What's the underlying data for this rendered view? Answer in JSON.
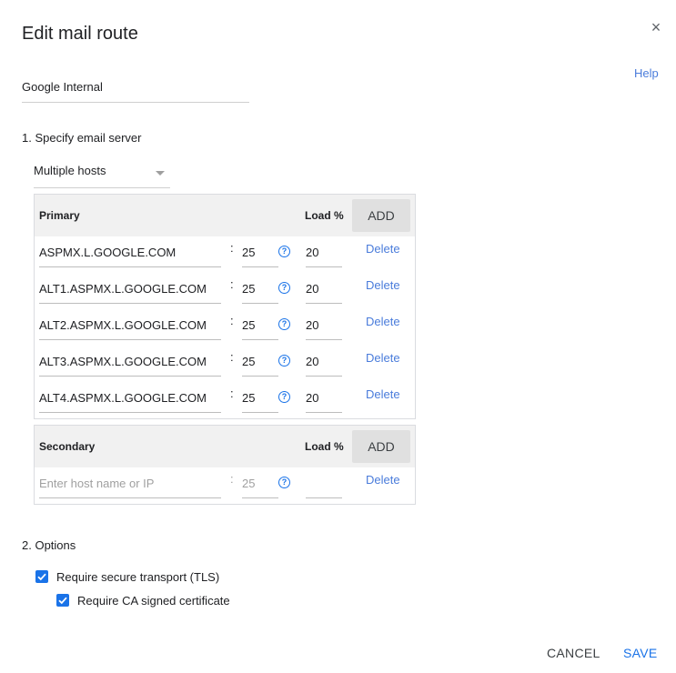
{
  "dialog": {
    "title": "Edit mail route",
    "close_glyph": "×",
    "help_label": "Help",
    "route_name": "Google Internal"
  },
  "server_section": {
    "label": "1. Specify email server",
    "mode_value": "Multiple hosts"
  },
  "primary": {
    "header": "Primary",
    "load_header": "Load %",
    "add_label": "ADD",
    "rows": [
      {
        "host": "ASPMX.L.GOOGLE.COM",
        "port": "25",
        "load": "20",
        "delete": "Delete"
      },
      {
        "host": "ALT1.ASPMX.L.GOOGLE.COM",
        "port": "25",
        "load": "20",
        "delete": "Delete"
      },
      {
        "host": "ALT2.ASPMX.L.GOOGLE.COM",
        "port": "25",
        "load": "20",
        "delete": "Delete"
      },
      {
        "host": "ALT3.ASPMX.L.GOOGLE.COM",
        "port": "25",
        "load": "20",
        "delete": "Delete"
      },
      {
        "host": "ALT4.ASPMX.L.GOOGLE.COM",
        "port": "25",
        "load": "20",
        "delete": "Delete"
      }
    ]
  },
  "secondary": {
    "header": "Secondary",
    "load_header": "Load %",
    "add_label": "ADD",
    "host_placeholder": "Enter host name or IP",
    "port_placeholder": "25",
    "load": "",
    "delete": "Delete"
  },
  "options": {
    "label": "2. Options",
    "tls_label": "Require secure transport (TLS)",
    "tls_checked": true,
    "ca_label": "Require CA signed certificate",
    "ca_checked": true
  },
  "footer": {
    "cancel_label": "CANCEL",
    "save_label": "SAVE"
  },
  "icons": {
    "close": "close-icon",
    "help": "help-circle-icon",
    "caret": "dropdown-caret-icon",
    "check": "checkbox-checked-icon"
  },
  "colors": {
    "accent": "#1a73e8",
    "link": "#4a7cdb",
    "header_bg": "#f1f1f1",
    "add_button_bg": "#e0e0e0"
  }
}
